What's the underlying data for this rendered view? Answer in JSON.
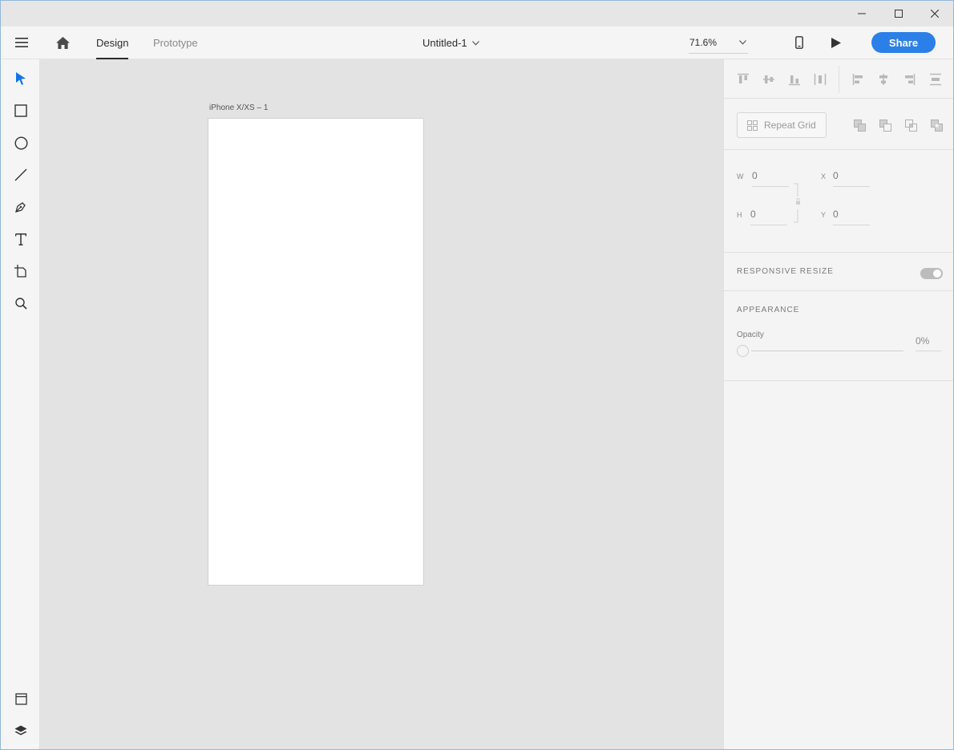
{
  "window": {
    "controls": [
      "minimize-icon",
      "maximize-icon",
      "close-icon"
    ]
  },
  "appbar": {
    "menu_icon": "hamburger-icon",
    "home_icon": "home-icon",
    "tabs": [
      {
        "label": "Design",
        "active": true
      },
      {
        "label": "Prototype",
        "active": false
      }
    ],
    "document_title": "Untitled-1",
    "zoom": "71.6%",
    "device_preview_icon": "phone-icon",
    "play_icon": "play-icon",
    "share_label": "Share",
    "accent_color": "#2b80e8"
  },
  "toolbar": {
    "tools": [
      "select-icon",
      "rectangle-icon",
      "ellipse-icon",
      "line-icon",
      "pen-icon",
      "text-icon",
      "artboard-icon",
      "zoom-icon"
    ],
    "bottom_tools": [
      "assets-icon",
      "layers-icon"
    ],
    "active_color": "#1473e6"
  },
  "canvas": {
    "artboard_label": "iPhone X/XS – 1"
  },
  "panel": {
    "repeat_grid_label": "Repeat Grid",
    "transform": {
      "w_label": "W",
      "w_value": "0",
      "h_label": "H",
      "h_value": "0",
      "x_label": "X",
      "x_value": "0",
      "y_label": "Y",
      "y_value": "0"
    },
    "responsive_resize_label": "RESPONSIVE RESIZE",
    "appearance_label": "APPEARANCE",
    "opacity_label": "Opacity",
    "opacity_value": "0%"
  }
}
